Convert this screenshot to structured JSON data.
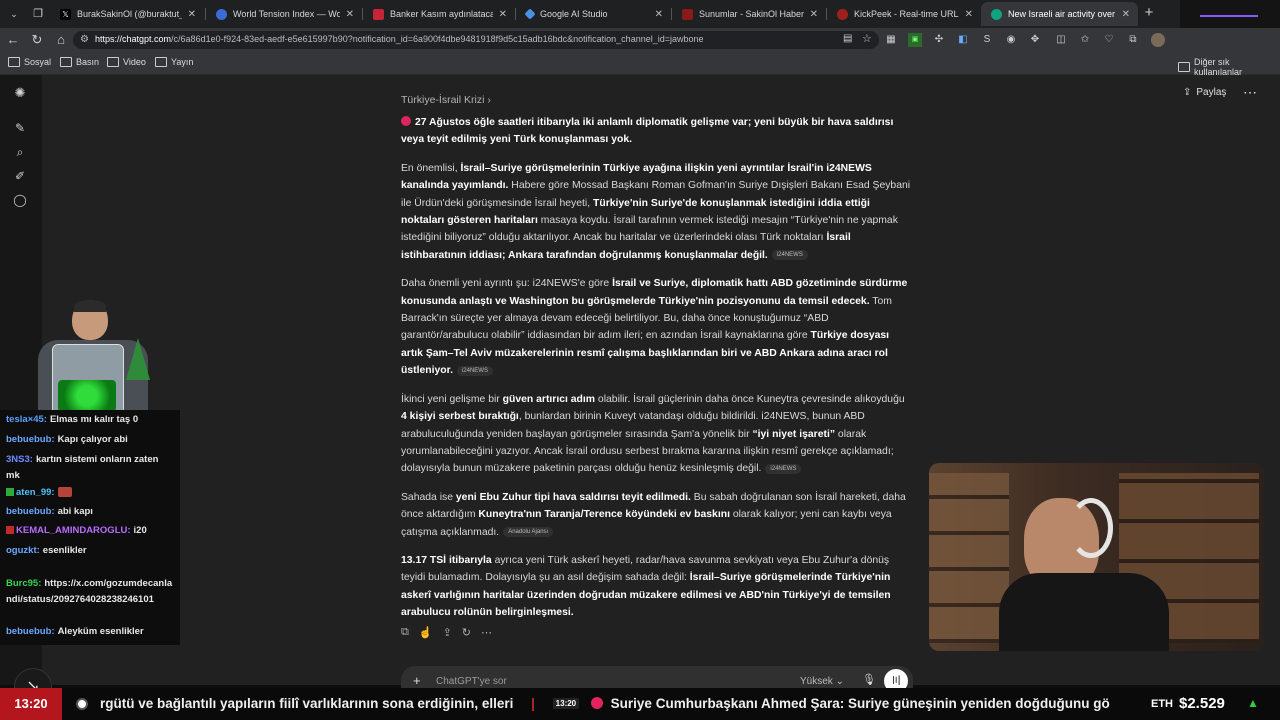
{
  "tabs": [
    {
      "title": "BurakSakinOl (@buraktut_) / X",
      "favicon_color": "#000000"
    },
    {
      "title": "World Tension Index — World Te",
      "favicon_color": "#3b6bd6"
    },
    {
      "title": "Banker Kasım aydınlatacak!",
      "favicon_color": "#c7243a"
    },
    {
      "title": "Google AI Studio",
      "favicon_color": "#4a90e2"
    },
    {
      "title": "Sunumlar - SakinOl Haber Merke",
      "favicon_color": "#8a1a1a"
    },
    {
      "title": "KickPeek - Real-time URL Crawle",
      "favicon_color": "#a02020"
    },
    {
      "title": "New Israeli air activity over Syria",
      "favicon_color": "#10a37f"
    }
  ],
  "address_bar": {
    "domain": "https://chatgpt.com",
    "path": "/c/6a86d1e0-f924-83ed-aedf-e5e615997b90?notification_id=6a900f4dbe9481918f9d5c15adb16bdc&notification_channel_id=jawbone"
  },
  "bookmarks": [
    "Sosyal",
    "Basın",
    "Video",
    "Yayın"
  ],
  "bookmarks_other": "Diğer sık kullanılanlar",
  "breadcrumb": "Türkiye-İsrail Krizi",
  "share_label": "Paylaş",
  "article": {
    "p1": {
      "b1": "27 Ağustos öğle saatleri itibarıyla iki anlamlı diplomatik gelişme var; yeni büyük bir hava saldırısı veya teyit edilmiş yeni Türk konuşlanması yok."
    },
    "p2": {
      "t1": "En önemlisi, ",
      "b1": "İsrail–Suriye görüşmelerinin Türkiye ayağına ilişkin yeni ayrıntılar İsrail'in i24NEWS kanalında yayımlandı.",
      "t2": " Habere göre Mossad Başkanı Roman Gofman'ın Suriye Dışişleri Bakanı Esad Şeybani ile Ürdün'deki görüşmesinde İsrail heyeti, ",
      "b2": "Türkiye'nin Suriye'de konuşlanmak istediğini iddia ettiği noktaları gösteren haritaları",
      "t3": " masaya koydu. İsrail tarafının vermek istediği mesajın “Türkiye'nin ne yapmak istediğini biliyoruz” olduğu aktarılıyor. Ancak bu haritalar ve üzerlerindeki olası Türk noktaları ",
      "b3": "İsrail istihbaratının iddiası; Ankara tarafından doğrulanmış konuşlanmalar değil.",
      "cite": "i24NEWS"
    },
    "p3": {
      "t1": "Daha önemli yeni ayrıntı şu: i24NEWS'e göre ",
      "b1": "İsrail ve Suriye, diplomatik hattı ABD gözetiminde sürdürme konusunda anlaştı ve Washington bu görüşmelerde Türkiye'nin pozisyonunu da temsil edecek.",
      "t2": " Tom Barrack'ın süreçte yer almaya devam edeceği belirtiliyor. Bu, daha önce konuştuğumuz “ABD garantör/arabulucu olabilir” iddiasından bir adım ileri; en azından İsrail kaynaklarına göre ",
      "b2": "Türkiye dosyası artık Şam–Tel Aviv müzakerelerinin resmî çalışma başlıklarından biri ve ABD Ankara adına aracı rol üstleniyor.",
      "cite": "i24NEWS"
    },
    "p4": {
      "t1": "İkinci yeni gelişme bir ",
      "b1": "güven artırıcı adım",
      "t2": " olabilir. İsrail güçlerinin daha önce Kuneytra çevresinde alıkoyduğu ",
      "b2": "4 kişiyi serbest bıraktığı",
      "t3": ", bunlardan birinin Kuveyt vatandaşı olduğu bildirildi. i24NEWS, bunun ABD arabuluculuğunda yeniden başlayan görüşmeler sırasında Şam'a yönelik bir ",
      "b3": "“iyi niyet işareti”",
      "t4": " olarak yorumlanabileceğini yazıyor. Ancak İsrail ordusu serbest bırakma kararına ilişkin resmî gerekçe açıklamadı; dolayısıyla bunun müzakere paketinin parçası olduğu henüz kesinleşmiş değil.",
      "cite": "i24NEWS"
    },
    "p5": {
      "t1": "Sahada ise ",
      "b1": "yeni Ebu Zuhur tipi hava saldırısı teyit edilmedi.",
      "t2": " Bu sabah doğrulanan son İsrail hareketi, daha önce aktardığım ",
      "b2": "Kuneytra'nın Taranja/Terence köyündeki ev baskını",
      "t3": " olarak kalıyor; yeni can kaybı veya çatışma açıklanmadı.",
      "cite": "Anadolu Ajansı"
    },
    "p6": {
      "b1": "13.17 TSİ itibarıyla",
      "t1": " ayrıca yeni Türk askerî heyeti, radar/hava savunma sevkiyatı veya Ebu Zuhur'a dönüş teyidi bulamadım. Dolayısıyla şu an asıl değişim sahada değil: ",
      "b2": "İsrail–Suriye görüşmelerinde Türkiye'nin askerî varlığının haritalar üzerinden doğrudan müzakere edilmesi ve ABD'nin Türkiye'yi de temsilen arabulucu rolünün belirginleşmesi."
    }
  },
  "composer": {
    "placeholder": "ChatGPT'ye sor",
    "mode": "Yüksek"
  },
  "chat": [
    {
      "user": "tesla×45:",
      "user_color": "#5aa0ff",
      "text": "Elmas mı kalır taş 0"
    },
    {
      "user": "bebuebub:",
      "user_color": "#6aa8ff",
      "text": "Kapı çalıyor abi"
    },
    {
      "user": "3NS3:",
      "user_color": "#6f8cff",
      "text": "kartın sistemi onların zaten mk"
    },
    {
      "user": "aten_99:",
      "user_color": "#4fc3f7",
      "text": ""
    },
    {
      "user": "bebuebub:",
      "user_color": "#6aa8ff",
      "text": "abi kapı"
    },
    {
      "user": "KEMAL_AMINDAROGLU:",
      "user_color": "#b86bff",
      "text": "i20"
    },
    {
      "user": "oguzkt:",
      "user_color": "#6aa8ff",
      "text": "esenlikler"
    },
    {
      "user": "Burc95:",
      "user_color": "#39d353",
      "text": "https://x.com/gozumdecanlandi/status/2092764028238246101"
    },
    {
      "user": "bebuebub:",
      "user_color": "#6aa8ff",
      "text": "Aleyküm esenlikler"
    }
  ],
  "ticker": {
    "time": "13:20",
    "text1": "rgütü ve bağlantılı yapıların fiilî varlıklarının sona erdiğinin, elleri",
    "inner_time": "13:20",
    "text2": "Suriye Cumhurbaşkanı Ahmed Şara: Suriye güneşinin yeniden doğduğunu gö",
    "eth_label": "ETH",
    "eth_value": "$2.529",
    "eth_trend": "▲",
    "trend_color": "#2ecc40",
    "bullet_color": "#e0245e"
  },
  "colors": {
    "accent_red": "#b3161c",
    "bg": "#212121",
    "sidebar": "#171717"
  }
}
